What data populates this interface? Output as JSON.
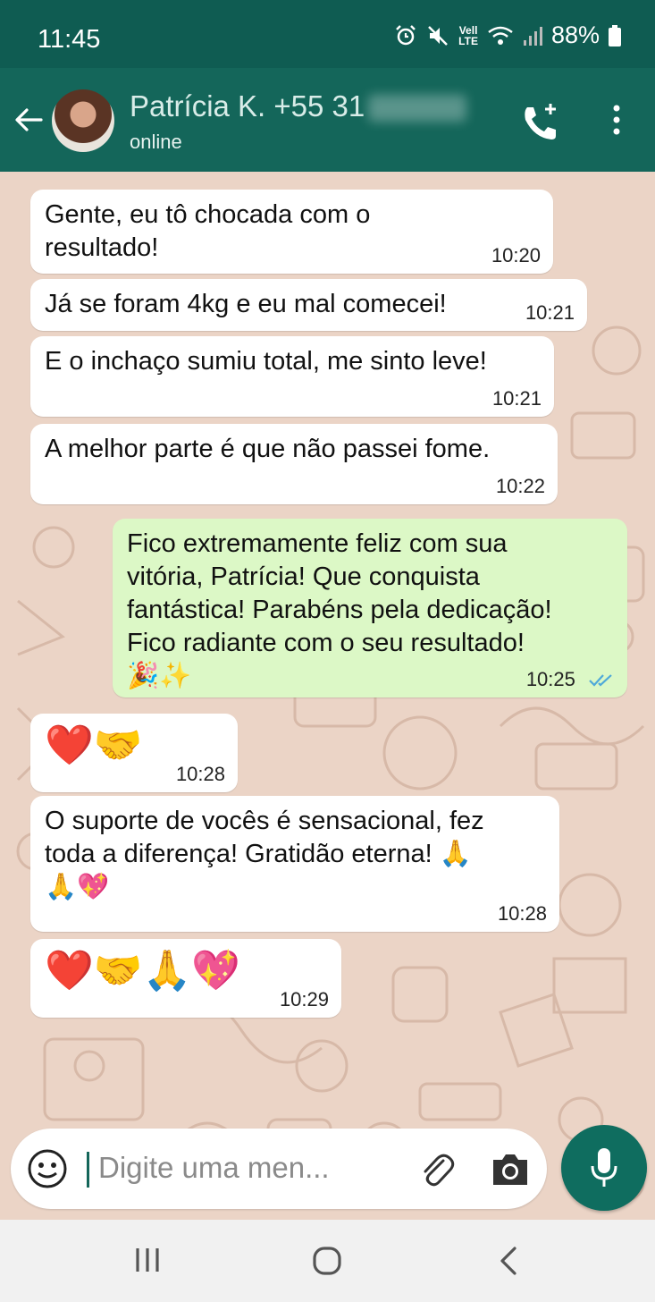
{
  "status_bar": {
    "time": "11:45",
    "network_label_top": "Vell",
    "network_label_bottom": "LTE",
    "battery": "88%"
  },
  "header": {
    "contact_name": "Patrícia K. +55 31",
    "contact_status": "online"
  },
  "messages": [
    {
      "text": "Gente, eu tô chocada com o\nresultado!",
      "time": "10:20",
      "direction": "in"
    },
    {
      "text": "Já se foram 4kg e eu mal comecei!",
      "time": "10:21",
      "direction": "in"
    },
    {
      "text": "E o inchaço sumiu total, me sinto leve!",
      "time": "10:21",
      "direction": "in"
    },
    {
      "text": "A melhor parte é que não passei fome.",
      "time": "10:22",
      "direction": "in"
    },
    {
      "text": "Fico extremamente feliz com sua\nvitória, Patrícia! Que conquista\nfantástica! Parabéns pela dedicação!\nFico radiante com o seu resultado!\n🎉✨",
      "time": "10:25",
      "direction": "out",
      "status": "read"
    },
    {
      "text": "❤️🤝",
      "time": "10:28",
      "direction": "in"
    },
    {
      "text": "O suporte de vocês é sensacional, fez\ntoda a diferença! Gratidão eterna! 🙏\n🙏💖",
      "time": "10:28",
      "direction": "in"
    },
    {
      "text": "❤️🤝🙏💖",
      "time": "10:29",
      "direction": "in"
    }
  ],
  "composer": {
    "placeholder": "Digite uma men..."
  },
  "colors": {
    "header": "#14665a",
    "status_bar": "#0f5c52",
    "outgoing_bubble": "#dcf8c6",
    "incoming_bubble": "#ffffff",
    "read_ticks": "#4fa9d9"
  },
  "icons": [
    "back-arrow-icon",
    "add-call-icon",
    "more-vert-icon",
    "emoji-icon",
    "attach-icon",
    "camera-icon",
    "mic-icon",
    "recents-icon",
    "home-icon",
    "back-icon"
  ]
}
